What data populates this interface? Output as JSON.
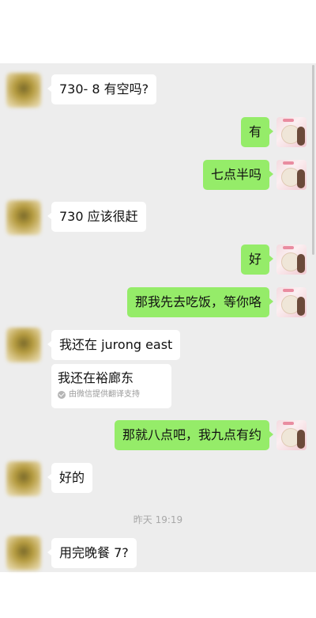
{
  "messages": [
    {
      "side": "left",
      "text": "730- 8 有空吗?"
    },
    {
      "side": "right",
      "text": "有"
    },
    {
      "side": "right",
      "text": "七点半吗"
    },
    {
      "side": "left",
      "text": "730 应该很赶"
    },
    {
      "side": "right",
      "text": "好"
    },
    {
      "side": "right",
      "text": "那我先去吃饭，等你咯"
    },
    {
      "side": "left",
      "text": "我还在 jurong east"
    },
    {
      "side": "left",
      "text": "我还在裕廊东",
      "translation_note": "由微信提供翻译支持"
    },
    {
      "side": "right",
      "text": "那就八点吧，我九点有约"
    },
    {
      "side": "left",
      "text": "好的"
    },
    {
      "side": "left",
      "text": "用完晚餐 7?"
    }
  ],
  "timestamp": "昨天 19:19",
  "colors": {
    "chat_background": "#ededed",
    "my_bubble": "#95ec69",
    "their_bubble": "#ffffff",
    "meta_text": "#a8a8a8"
  }
}
